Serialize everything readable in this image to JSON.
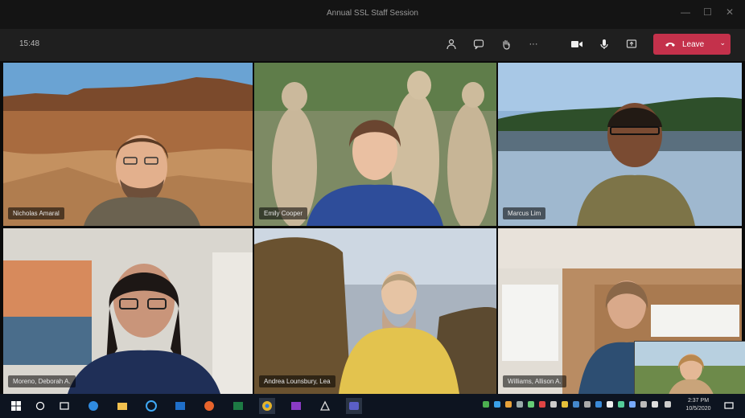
{
  "window": {
    "title": "Annual SSL Staff Session",
    "minimize": "—",
    "maximize": "☐",
    "close": "✕"
  },
  "toolbar": {
    "timer": "15:48",
    "leave_label": "Leave",
    "more_label": "···"
  },
  "participants": [
    {
      "name": "Nicholas Amaral"
    },
    {
      "name": "Emily Cooper"
    },
    {
      "name": "Marcus Lim"
    },
    {
      "name": "Moreno, Deborah A."
    },
    {
      "name": "Andrea Lounsbury, Lea"
    },
    {
      "name": "Williams, Allison A."
    }
  ],
  "taskbar": {
    "time": "2:37 PM",
    "date": "10/5/2020"
  },
  "colors": {
    "leave_red": "#c4314b",
    "taskbar_bg": "#0d1420",
    "toolbar_bg": "#1f1f1f"
  }
}
